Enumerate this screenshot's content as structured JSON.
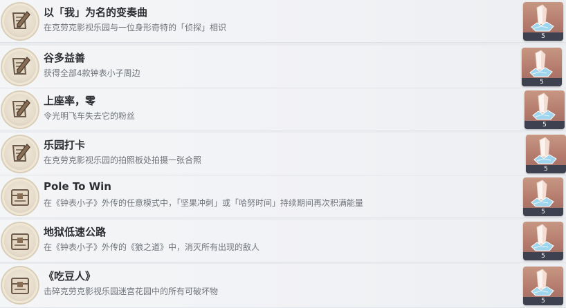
{
  "achievements": [
    {
      "title": "以「我」为名的变奏曲",
      "description": "在克劳克影视乐园与一位身形奇特的「侦探」相识",
      "reward_count": "5",
      "badge_icon": "pen-scroll-badge-icon"
    },
    {
      "title": "谷多益善",
      "description": "获得全部4款钟表小子周边",
      "reward_count": "5",
      "badge_icon": "pen-scroll-badge-icon"
    },
    {
      "title": "上座率，零",
      "description": "令光明飞车失去它的粉丝",
      "reward_count": "5",
      "badge_icon": "pen-scroll-badge-icon"
    },
    {
      "title": "乐园打卡",
      "description": "在克劳克影视乐园的拍照板处拍摄一张合照",
      "reward_count": "5",
      "badge_icon": "pen-scroll-badge-icon"
    },
    {
      "title": "Pole To Win",
      "description": "在《钟表小子》外传的任意模式中，「坚果冲刺」或「哈努时间」持续期间再次积满能量",
      "reward_count": "5",
      "badge_icon": "chest-badge-icon"
    },
    {
      "title": "地狱低速公路",
      "description": "在《钟表小子》外传的《狼之道》中，消灭所有出现的敌人",
      "reward_count": "5",
      "badge_icon": "chest-badge-icon"
    },
    {
      "title": "《吃豆人》",
      "description": "击碎克劳克影视乐园迷宫花园中的所有可破坏物",
      "reward_count": "5",
      "badge_icon": "chest-badge-icon"
    }
  ],
  "reward_item": "crystal-icon",
  "colors": {
    "reward_bg": "#b47b6d",
    "title": "#2b2d31",
    "description": "#6f7379"
  }
}
